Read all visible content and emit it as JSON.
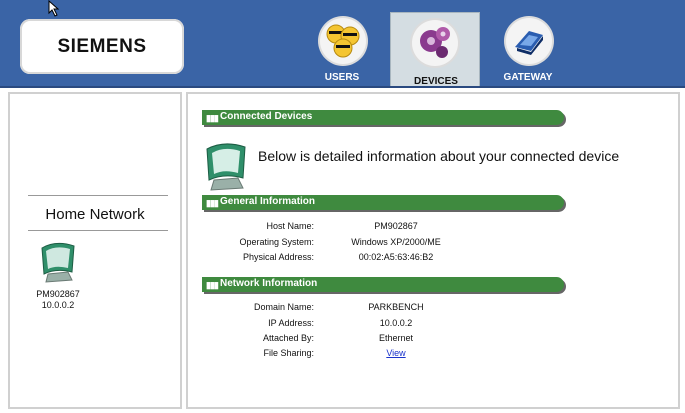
{
  "brand": {
    "logo_text": "SIEMENS"
  },
  "tabs": [
    {
      "label": "USERS",
      "icon": "users-icon",
      "active": false
    },
    {
      "label": "DEVICES",
      "icon": "devices-icon",
      "active": true
    },
    {
      "label": "GATEWAY",
      "icon": "gateway-icon",
      "active": false
    }
  ],
  "sidebar": {
    "title": "Home Network",
    "device": {
      "name": "PM902867",
      "ip": "10.0.0.2",
      "icon": "computer-monitor-icon"
    }
  },
  "main": {
    "connected_title": "Connected Devices",
    "intro": "Below is detailed information about your connected device",
    "general": {
      "title": "General Information",
      "rows": [
        {
          "label": "Host Name:",
          "value": "PM902867"
        },
        {
          "label": "Operating System:",
          "value": "Windows XP/2000/ME"
        },
        {
          "label": "Physical Address:",
          "value": "00:02:A5:63:46:B2"
        }
      ]
    },
    "network": {
      "title": "Network Information",
      "rows": [
        {
          "label": "Domain Name:",
          "value": "PARKBENCH"
        },
        {
          "label": "IP Address:",
          "value": "10.0.0.2"
        },
        {
          "label": "Attached By:",
          "value": "Ethernet"
        },
        {
          "label": "File Sharing:",
          "value": "View",
          "link": true
        }
      ]
    }
  },
  "colors": {
    "header": "#3a64a6",
    "section_bar": "#3f8a3f",
    "link": "#1a33cc"
  }
}
